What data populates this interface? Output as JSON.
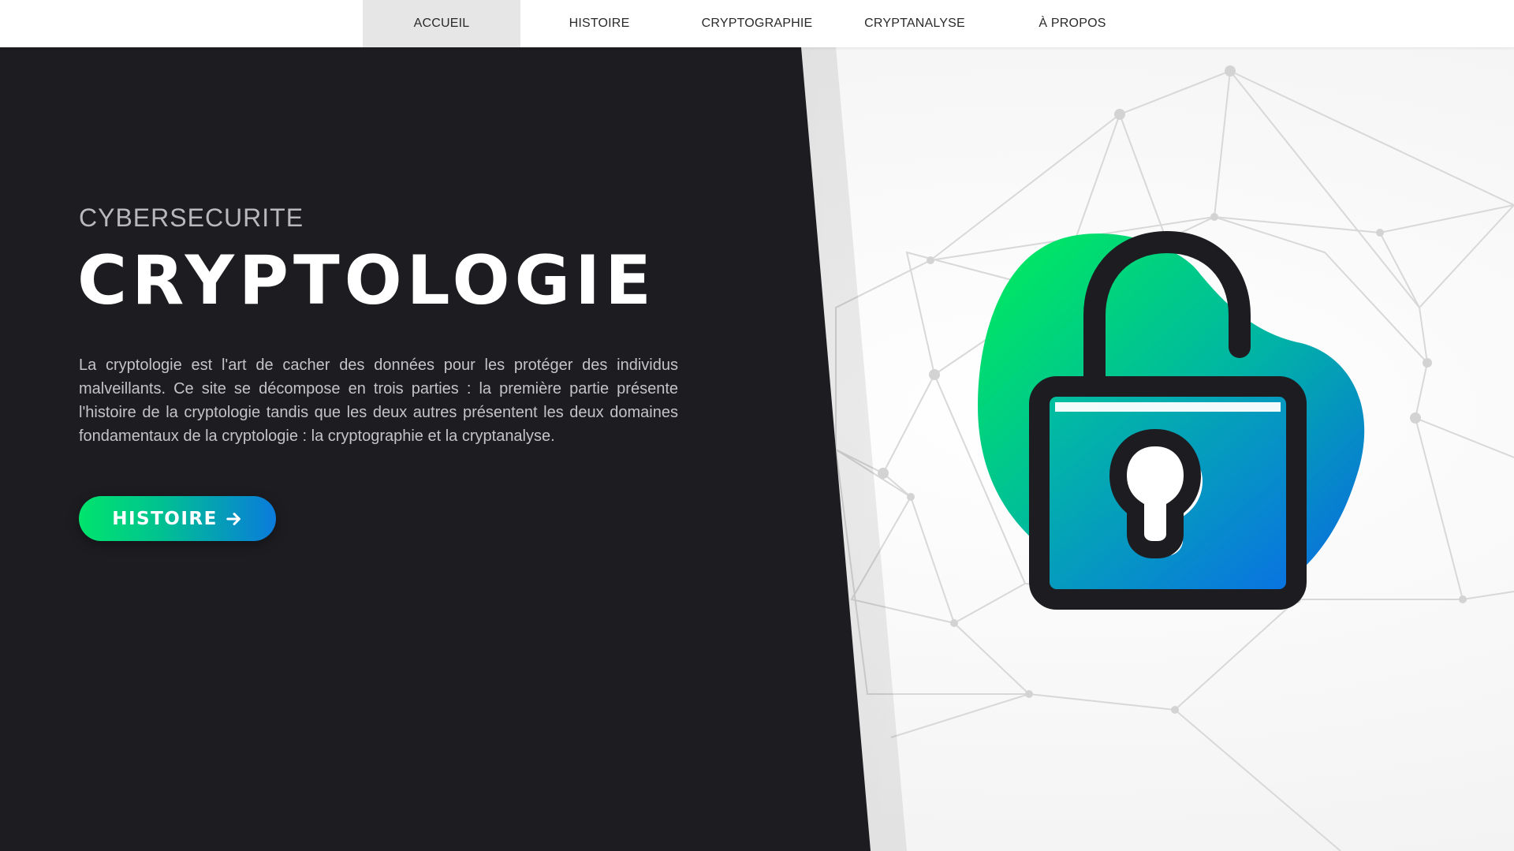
{
  "nav": {
    "items": [
      {
        "label": "ACCUEIL",
        "active": true
      },
      {
        "label": "HISTOIRE",
        "active": false
      },
      {
        "label": "CRYPTOGRAPHIE",
        "active": false
      },
      {
        "label": "CRYPTANALYSE",
        "active": false
      },
      {
        "label": "À PROPOS",
        "active": false
      }
    ]
  },
  "hero": {
    "kicker": "CYBERSECURITE",
    "title": "CRYPTOLOGIE",
    "description": "La cryptologie est l'art de cacher des données pour les protéger des individus malveillants. Ce site se décompose en trois parties : la première partie présente l'histoire de la cryptologie tandis que les deux autres présentent les deux domaines fondamentaux de la cryptologie : la cryptographie et la cryptanalyse.",
    "cta_label": "HISTOIRE",
    "cta_icon": "arrow-right-icon"
  },
  "illustration": {
    "icon": "unlocked-padlock-icon",
    "colors": {
      "gradient_start": "#00e85f",
      "gradient_end": "#0a6fe6",
      "outline": "#1d1c21"
    }
  },
  "colors": {
    "dark_panel": "#1d1c21",
    "nav_active_bg": "#e6e6e6",
    "accent_green": "#00e46d",
    "accent_blue": "#0a7bdc"
  }
}
